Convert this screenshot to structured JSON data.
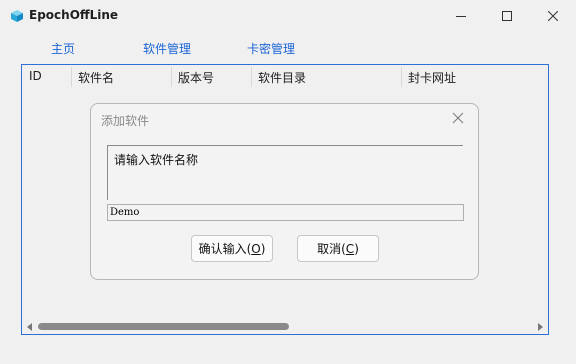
{
  "window": {
    "title": "EpochOffLine",
    "accent": "#2f6fd6"
  },
  "tabs": [
    {
      "label": "主页"
    },
    {
      "label": "软件管理"
    },
    {
      "label": "卡密管理"
    }
  ],
  "table": {
    "columns": [
      "ID",
      "软件名",
      "版本号",
      "软件目录",
      "封卡网址"
    ]
  },
  "dialog": {
    "title": "添加软件",
    "prompt": "请输入软件名称",
    "input_value": "Demo",
    "ok_label": "确认输入(",
    "ok_key": "O",
    "ok_end": ")",
    "cancel_label": "取消(",
    "cancel_key": "C",
    "cancel_end": ")"
  },
  "icons": {
    "app": "cube-icon",
    "minimize": "minimize-icon",
    "maximize": "maximize-icon",
    "close": "close-icon"
  }
}
